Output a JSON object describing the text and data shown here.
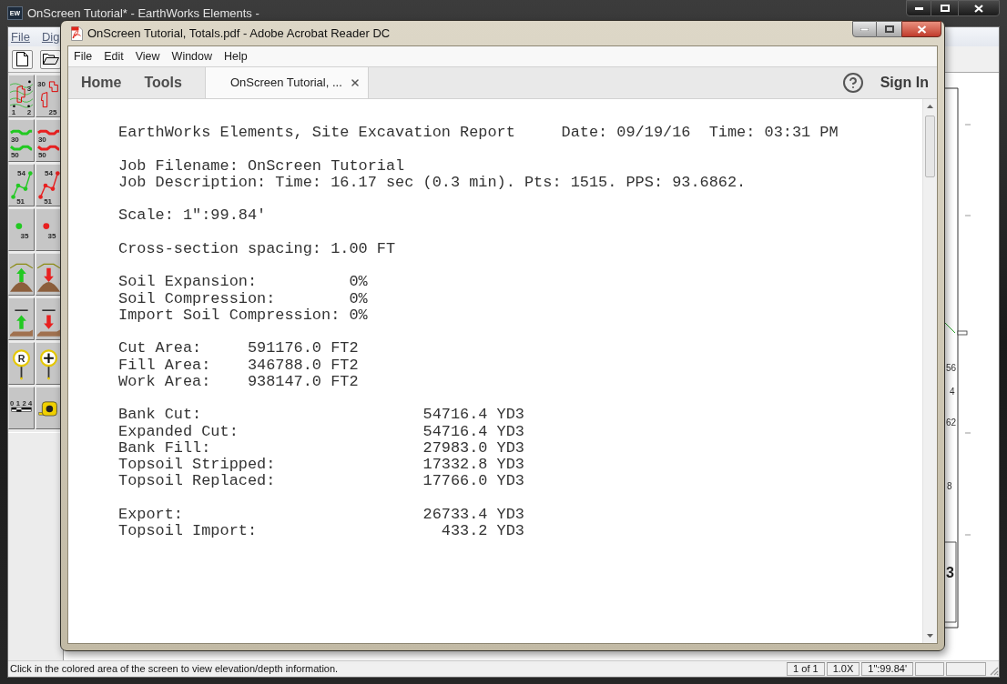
{
  "background_window": {
    "logo": "EW",
    "title": "OnScreen Tutorial* - EarthWorks Elements -",
    "menu": [
      "File",
      "Dig"
    ],
    "toolbar": [
      {
        "kind": "new-document"
      },
      {
        "kind": "open-folder"
      }
    ],
    "tool_palette": [
      {
        "kind": "site-lines",
        "labels": [
          "3",
          "1",
          "2"
        ]
      },
      {
        "kind": "boundary-region",
        "labels": [
          "30",
          "25"
        ]
      },
      {
        "kind": "contours",
        "color": "#22c922",
        "labels": [
          "30",
          "50"
        ]
      },
      {
        "kind": "contours",
        "color": "#e82020",
        "labels": [
          "30",
          "50"
        ]
      },
      {
        "kind": "profile",
        "color": "#22c922",
        "labels": [
          "54",
          "51"
        ]
      },
      {
        "kind": "profile",
        "color": "#e82020",
        "labels": [
          "54",
          "51"
        ]
      },
      {
        "kind": "point",
        "color": "#22c922",
        "labels": [
          "35"
        ]
      },
      {
        "kind": "point",
        "color": "#e82020",
        "labels": [
          "35"
        ]
      },
      {
        "kind": "mound-raise",
        "color": "#22c922"
      },
      {
        "kind": "mound-lower",
        "color": "#e82020"
      },
      {
        "kind": "level-raise",
        "color": "#22c922"
      },
      {
        "kind": "level-lower",
        "color": "#e82020"
      },
      {
        "kind": "zoom-reset",
        "labels": [
          "R"
        ]
      },
      {
        "kind": "zoom-in"
      },
      {
        "kind": "scale-bar",
        "labels": [
          "0",
          "1",
          "2",
          "4"
        ]
      },
      {
        "kind": "tape-measure"
      }
    ],
    "canvas_labels": [
      "56",
      "4",
      "62",
      "8",
      "3"
    ],
    "status_bar": {
      "message": "Click in the colored area of the screen to view elevation/depth information.",
      "panels": [
        "1 of 1",
        "1.0X",
        "1\":99.84'"
      ]
    }
  },
  "document_window": {
    "title": "OnScreen Tutorial, Totals.pdf - Adobe Acrobat Reader DC",
    "menu": [
      "File",
      "Edit",
      "View",
      "Window",
      "Help"
    ],
    "tabs": [
      {
        "label": "Home",
        "kind": "nav",
        "selected": false
      },
      {
        "label": "Tools",
        "kind": "nav",
        "selected": false
      },
      {
        "label": "OnScreen Tutorial, ...",
        "kind": "document",
        "selected": true
      }
    ],
    "sign_in": "Sign In",
    "report": [
      [
        "EarthWorks Elements, Site Excavation Report     Date: 09/19/16  Time: 03:31 PM"
      ],
      [
        "Job Filename: OnScreen Tutorial",
        "Job Description: Time: 16.17 sec (0.3 min). Pts: 1515. PPS: 93.6862."
      ],
      [
        "Scale: 1\":99.84'"
      ],
      [
        "Cross-section spacing: 1.00 FT"
      ],
      [
        "Soil Expansion:          0%",
        "Soil Compression:        0%",
        "Import Soil Compression: 0%"
      ],
      [
        "Cut Area:     591176.0 FT2",
        "Fill Area:    346788.0 FT2",
        "Work Area:    938147.0 FT2"
      ],
      [
        "Bank Cut:                        54716.4 YD3",
        "Expanded Cut:                    54716.4 YD3",
        "Bank Fill:                       27983.0 YD3",
        "Topsoil Stripped:                17332.8 YD3",
        "Topsoil Replaced:                17766.0 YD3"
      ],
      [
        "Export:                          26733.4 YD3",
        "Topsoil Import:                    433.2 YD3"
      ]
    ]
  }
}
